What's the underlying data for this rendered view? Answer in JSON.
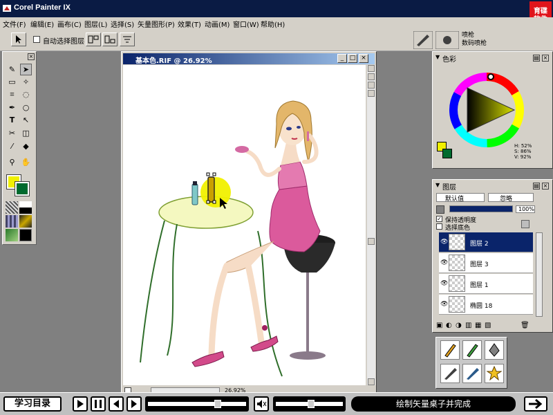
{
  "app": {
    "title": "Corel Painter IX",
    "brand_logo_line1": "育碟",
    "brand_logo_line2": "软件"
  },
  "menu": [
    "文件(F)",
    "编辑(E)",
    "画布(C)",
    "图层(L)",
    "选择(S)",
    "矢量图形(P)",
    "效果(T)",
    "动画(M)",
    "窗口(W)",
    "帮助(H)"
  ],
  "toolbar": {
    "auto_select_label": "自动选择图层",
    "brush_category": "喷枪",
    "brush_variant": "数码喷枪"
  },
  "document": {
    "title": "基本色.RIF @ 26.92%",
    "zoom": "26.92%"
  },
  "color_panel": {
    "title": "色彩",
    "h": "H: 52%",
    "s": "S: 86%",
    "v": "V: 92%",
    "main_color": "#f0f000",
    "paper_color": "#006a2e"
  },
  "layers_panel": {
    "title": "图层",
    "composite_method": "默认值",
    "preset": "忽略",
    "opacity": "100%",
    "preserve_transparency": "保持透明度",
    "pick_up_color": "选择底色",
    "layers": [
      {
        "name": "图层 2"
      },
      {
        "name": "图层 3"
      },
      {
        "name": "图层 1"
      },
      {
        "name": "椭圆 18"
      }
    ]
  },
  "bottom_bar": {
    "menu_button": "学习目录",
    "caption": "绘制矢量桌子并完成"
  }
}
